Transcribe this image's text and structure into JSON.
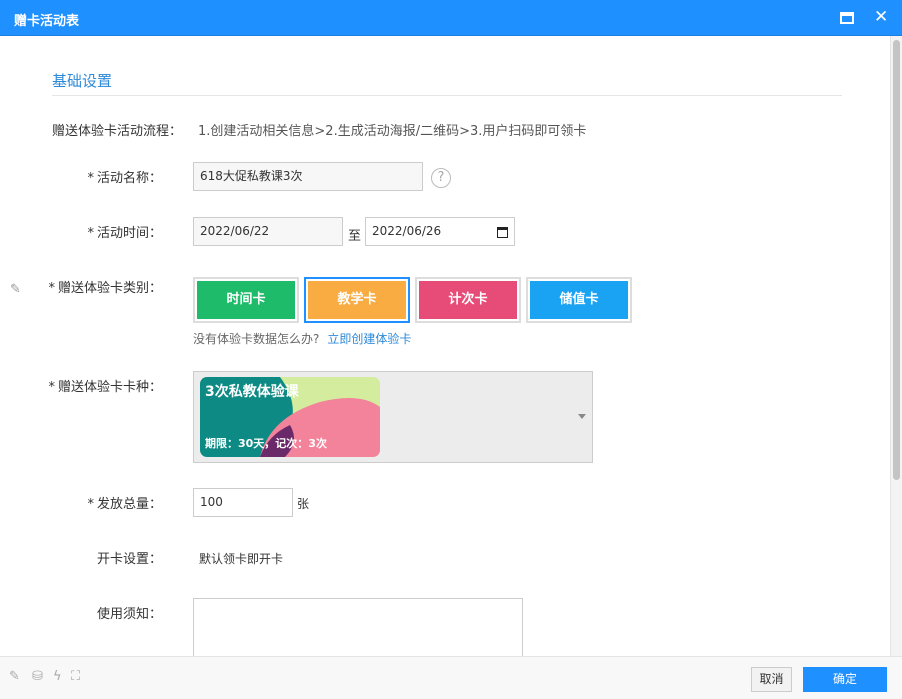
{
  "window": {
    "title": "赠卡活动表"
  },
  "section": {
    "title": "基础设置"
  },
  "flow": {
    "label": "赠送体验卡活动流程：",
    "text": "1.创建活动相关信息>2.生成活动海报/二维码>3.用户扫码即可领卡"
  },
  "fields": {
    "name": {
      "label": "活动名称：",
      "value": "618大促私教课3次",
      "required": true
    },
    "time": {
      "label": "活动时间：",
      "start": "2022/06/22",
      "separator": "至",
      "end": "2022/06/26",
      "required": true
    },
    "card_category": {
      "label": "赠送体验卡类别：",
      "required": true
    },
    "card_kind": {
      "label": "赠送体验卡卡种：",
      "required": true
    },
    "total": {
      "label": "发放总量：",
      "value": "100",
      "unit": "张",
      "required": true
    },
    "open_setting": {
      "label": "开卡设置：",
      "value": "默认领卡即开卡"
    },
    "notice": {
      "label": "使用须知：",
      "value": ""
    }
  },
  "card_types": [
    {
      "label": "时间卡",
      "color": "#1dbb6a",
      "active": false
    },
    {
      "label": "教学卡",
      "color": "#f8ac42",
      "active": true
    },
    {
      "label": "计次卡",
      "color": "#e74c78",
      "active": false
    },
    {
      "label": "储值卡",
      "color": "#1aa3f2",
      "active": false
    }
  ],
  "hint": {
    "text": "没有体验卡数据怎么办?",
    "link": "立即创建体验卡"
  },
  "selected_card": {
    "name": "3次私教体验课",
    "meta": "期限：30天，记次：3次"
  },
  "footer": {
    "cancel_label": "取消",
    "ok_label": "确定"
  },
  "colors": {
    "accent": "#1e90ff",
    "section_title": "#2e8ad8"
  }
}
